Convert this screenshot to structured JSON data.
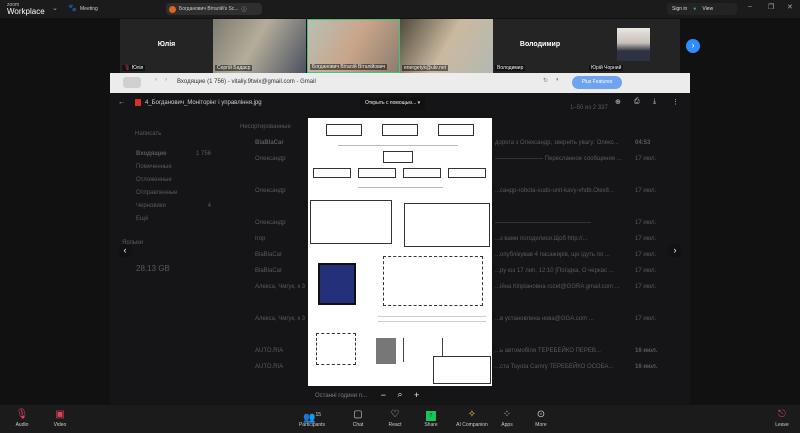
{
  "app": {
    "brand_small": "zoom",
    "brand": "Workplace",
    "meeting_label": "Meeting",
    "share_pill": "Богданович Віталій's Sc...",
    "sign_in": "Sign in",
    "view": "View"
  },
  "participants": [
    {
      "name": "Юлія",
      "label": "Юлія",
      "video": false
    },
    {
      "name": "Сергій Бадаєр",
      "video": true
    },
    {
      "name": "Богданович Віталій Віталійович",
      "video": true
    },
    {
      "name": "energetyk@ukr.net",
      "video": true
    },
    {
      "name": "Володимир",
      "label": "Володимир",
      "video": false
    },
    {
      "name": "Юрій Чорний",
      "video": false
    }
  ],
  "browser": {
    "title": "Входящие (1 756) - vitaliy.9twix@gmail.com - Gmail",
    "plus_features": "Plus Features"
  },
  "viewer": {
    "file_name": "4_Богданович_Моніторінг і управління.jpg",
    "open_with": "Открыть с помощью...",
    "zoom_out": "−",
    "zoom_fit": "⌕",
    "zoom_in": "+"
  },
  "gmail": {
    "compose": "Написать",
    "folders": [
      {
        "label": "Входящие",
        "count": "1 756"
      },
      {
        "label": "Помеченные",
        "count": ""
      },
      {
        "label": "Отложенные",
        "count": ""
      },
      {
        "label": "Отправленные",
        "count": ""
      },
      {
        "label": "Черновики",
        "count": "4"
      },
      {
        "label": "Ещё",
        "count": ""
      }
    ],
    "labels_heading": "Ярлыки",
    "storage_used": "28.13 GB",
    "tab_primary": "Несортированные",
    "pagination": "1–50 из 2 337",
    "rows": [
      {
        "sender": "BlaBlaCar",
        "snippet": "дорога з Олександр, зверніть увагу: Олекс...",
        "time": "04:53"
      },
      {
        "sender": "Олександр",
        "snippet": "———————— Пересланное сообщение ...",
        "time": "17 июл."
      },
      {
        "sender": "Олександр",
        "snippet": "...сандр-robota-sudo-unit-kavy-vhdb.Olex8...",
        "time": "17 июл."
      },
      {
        "sender": "Олександр",
        "snippet": "————————————————",
        "time": "17 июл."
      },
      {
        "sender": "Ігор",
        "snippet": "...з вами погодилися.Щоб http://...",
        "time": "17 июл."
      },
      {
        "sender": "BlaBlaCar",
        "snippet": "...опублікував 4 пасажирів, що їдуть по ...",
        "time": "17 июл."
      },
      {
        "sender": "BlaBlaCar",
        "snippet": "...ру юз 17 лип, 12:10 [Поїздка, О черкас ...",
        "time": "17 июл."
      },
      {
        "sender": "Алекса, Чмгук, к 3",
        "snippet": "...ійна Кіпріановна rozet@GGRA gmail.com ...",
        "time": "17 июл."
      },
      {
        "sender": "Алекса, Чмгук, к 3",
        "snippet": "...в установлена нова@GGA.com ...",
        "time": "17 июл."
      },
      {
        "sender": "AUTO.RIA",
        "snippet": "...ь автомобіля ТЕРЕБЕЙКО ПЕРЕВ...",
        "time": "16 июл."
      },
      {
        "sender": "AUTO.RIA",
        "snippet": "...ста Toyota Camry ТЕРЕБЕЙКО ОСОБА...",
        "time": "16 июл."
      }
    ],
    "bottom_peek": "Останні години п..."
  },
  "toolbar": {
    "audio": "Audio",
    "video": "Video",
    "participants": "Participants",
    "participants_count": "15",
    "chat": "Chat",
    "react": "React",
    "share": "Share",
    "ai": "AI Companion",
    "apps": "Apps",
    "more": "More",
    "leave": "Leave"
  },
  "colors": {
    "share_green": "#19c35a",
    "accent_blue": "#2d8cff",
    "plus_blue": "#6fa2ef",
    "active_border": "#3ec47d"
  }
}
